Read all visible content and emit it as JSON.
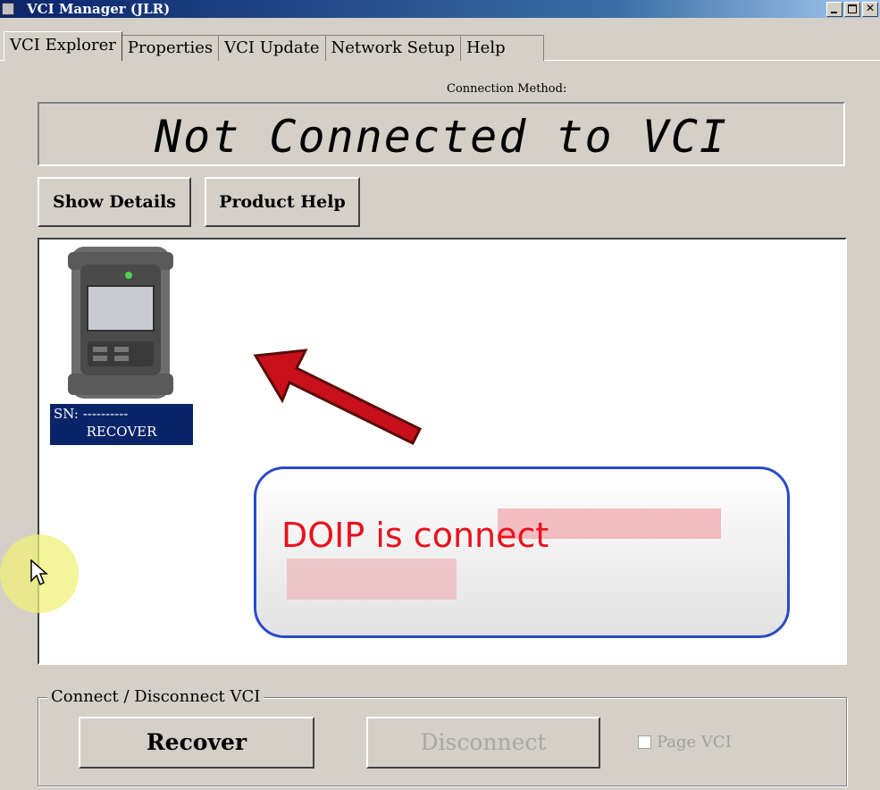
{
  "window": {
    "title": "VCI Manager (JLR)"
  },
  "tabs": [
    "VCI Explorer",
    "Properties",
    "VCI Update",
    "Network Setup",
    "Help"
  ],
  "connection": {
    "method_label": "Connection Method:",
    "status": "Not Connected to VCI"
  },
  "buttons": {
    "show_details": "Show Details",
    "product_help": "Product Help"
  },
  "device": {
    "sn": "SN: ----------",
    "status": "RECOVER"
  },
  "annotation": {
    "text": "DOIP is connect",
    "arrow_color": "#c8101a",
    "border_color": "#2a4bc8",
    "text_color": "#e8121e"
  },
  "group": {
    "label": "Connect / Disconnect VCI",
    "recover": "Recover",
    "disconnect": "Disconnect",
    "page_vci": "Page VCI",
    "page_vci_checked": false
  }
}
